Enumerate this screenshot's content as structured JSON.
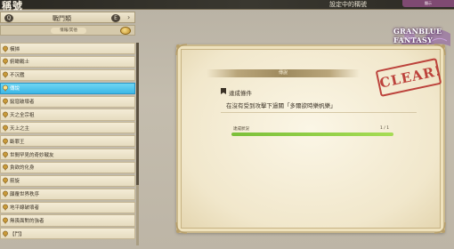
{
  "header": {
    "page_title": "稱號",
    "current_title_label": "設定中的稱號",
    "corner_tab": "顯示"
  },
  "logo": {
    "name": "GRANBLUE FANTASY",
    "subtitle": "RELINK"
  },
  "category": {
    "left_button": "Q",
    "label": "戰鬥類",
    "right_button": "E",
    "arrow": "›"
  },
  "filter": {
    "label": "情報/其他"
  },
  "titles": [
    {
      "label": "橫掃",
      "selected": false
    },
    {
      "label": "俯瞰戰士",
      "selected": false
    },
    {
      "label": "不沉艦",
      "selected": false
    },
    {
      "label": "傳說",
      "selected": true
    },
    {
      "label": "窮寇破壞者",
      "selected": false
    },
    {
      "label": "天之全宗祖",
      "selected": false
    },
    {
      "label": "天上之主",
      "selected": false
    },
    {
      "label": "斷罪王",
      "selected": false
    },
    {
      "label": "世間罕見的奇妙戰友",
      "selected": false
    },
    {
      "label": "貪欲的化身",
      "selected": false
    },
    {
      "label": "箭旋",
      "selected": false
    },
    {
      "label": "顛覆世界秩序",
      "selected": false
    },
    {
      "label": "地平線破壞者",
      "selected": false
    },
    {
      "label": "無畏面對的強者",
      "selected": false
    },
    {
      "label": "【鬥】",
      "selected": false
    }
  ],
  "detail": {
    "header_label": "傳說",
    "condition_heading": "達成條件",
    "condition_text": "在沒有受到攻擊下過關「多爾欲時樂帆樂」",
    "progress_label": "達成狀況",
    "progress_count": "1 / 1",
    "progress_fraction": 1.0,
    "stamp": "CLEAR!"
  },
  "colors": {
    "selected_item": "#3db8e6",
    "stamp": "#b7312c",
    "progress": "#7bbf3a"
  }
}
